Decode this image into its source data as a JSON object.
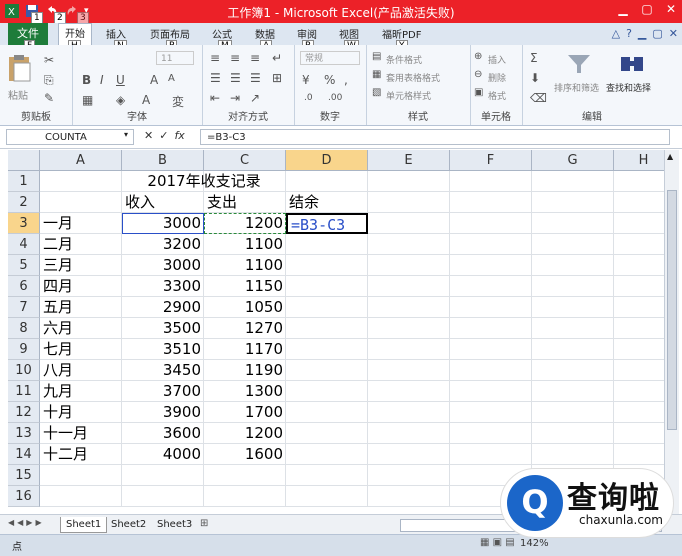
{
  "window": {
    "title": "工作簿1 - Microsoft Excel(产品激活失败)",
    "qa_keytips": [
      "1",
      "2",
      "3"
    ]
  },
  "tabs": [
    {
      "label": "文件",
      "key": "F"
    },
    {
      "label": "开始",
      "key": "H"
    },
    {
      "label": "插入",
      "key": "N"
    },
    {
      "label": "页面布局",
      "key": "P"
    },
    {
      "label": "公式",
      "key": "M"
    },
    {
      "label": "数据",
      "key": "A"
    },
    {
      "label": "审阅",
      "key": "R"
    },
    {
      "label": "视图",
      "key": "W"
    },
    {
      "label": "福昕PDF",
      "key": "Y"
    }
  ],
  "ribbon": {
    "clipboard": {
      "label": "剪贴板",
      "paste": "粘贴"
    },
    "font": {
      "label": "字体",
      "size": "11"
    },
    "align": {
      "label": "对齐方式"
    },
    "number": {
      "label": "数字",
      "format": "常规"
    },
    "styles": {
      "label": "样式",
      "items": [
        "条件格式",
        "套用表格格式",
        "单元格样式"
      ]
    },
    "cells": {
      "label": "单元格",
      "items": [
        "插入",
        "删除",
        "格式"
      ]
    },
    "editing": {
      "label": "编辑",
      "sort": "排序和筛选",
      "find": "查找和选择"
    }
  },
  "formula_bar": {
    "name_box": "COUNTA",
    "formula": "=B3-C3"
  },
  "columns": [
    "A",
    "B",
    "C",
    "D",
    "E",
    "F",
    "G",
    "H"
  ],
  "rows": [
    "1",
    "2",
    "3",
    "4",
    "5",
    "6",
    "7",
    "8",
    "9",
    "10",
    "11",
    "12",
    "13",
    "14",
    "15",
    "16"
  ],
  "table": {
    "title": "2017年收支记录",
    "headers": [
      "收入",
      "支出",
      "结余"
    ],
    "editing_cell": "=B3-C3",
    "data": [
      [
        "一月",
        "3000",
        "1200"
      ],
      [
        "二月",
        "3200",
        "1100"
      ],
      [
        "三月",
        "3000",
        "1100"
      ],
      [
        "四月",
        "3300",
        "1150"
      ],
      [
        "五月",
        "2900",
        "1050"
      ],
      [
        "六月",
        "3500",
        "1270"
      ],
      [
        "七月",
        "3510",
        "1170"
      ],
      [
        "八月",
        "3450",
        "1190"
      ],
      [
        "九月",
        "3700",
        "1300"
      ],
      [
        "十月",
        "3900",
        "1700"
      ],
      [
        "十一月",
        "3600",
        "1200"
      ],
      [
        "十二月",
        "4000",
        "1600"
      ]
    ]
  },
  "sheets": [
    "Sheet1",
    "Sheet2",
    "Sheet3"
  ],
  "status": {
    "mode": "点",
    "zoom": "142%"
  },
  "watermark": {
    "logo": "Q",
    "text": "查询啦",
    "url": "chaxunla.com"
  },
  "colors": {
    "titlebar": "#ec2128",
    "file_tab": "#1e7c3a",
    "selection": "#1f4fa8",
    "formula_ref_b": "#2a4fc8",
    "formula_ref_c": "#2a8a3a"
  }
}
